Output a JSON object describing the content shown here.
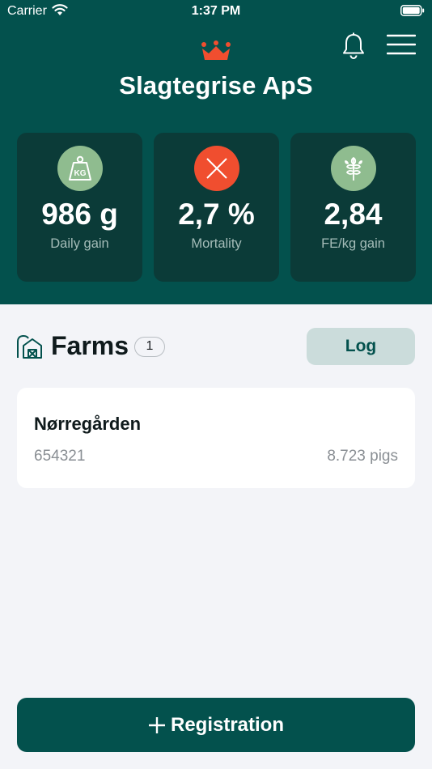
{
  "status_bar": {
    "carrier": "Carrier",
    "time": "1:37 PM"
  },
  "header": {
    "company_name": "Slagtegrise ApS",
    "logo_icon": "crown-icon",
    "notification_icon": "bell-icon",
    "menu_icon": "hamburger-menu-icon",
    "background_color": "#03514d"
  },
  "kpis": [
    {
      "value": "986 g",
      "label": "Daily gain",
      "icon": "weight-kg-icon",
      "icon_text": "KG",
      "badge_color": "#8fbc8f"
    },
    {
      "value": "2,7 %",
      "label": "Mortality",
      "icon": "close-x-icon",
      "badge_color": "#f04e2f"
    },
    {
      "value": "2,84",
      "label": "FE/kg gain",
      "icon": "wheat-icon",
      "badge_color": "#8fbc8f"
    }
  ],
  "farms": {
    "title": "Farms",
    "count": "1",
    "log_label": "Log",
    "items": [
      {
        "name": "Nørregården",
        "id": "654321",
        "pigs": "8.723 pigs"
      }
    ]
  },
  "registration": {
    "label": "Registration",
    "icon": "plus-icon"
  }
}
